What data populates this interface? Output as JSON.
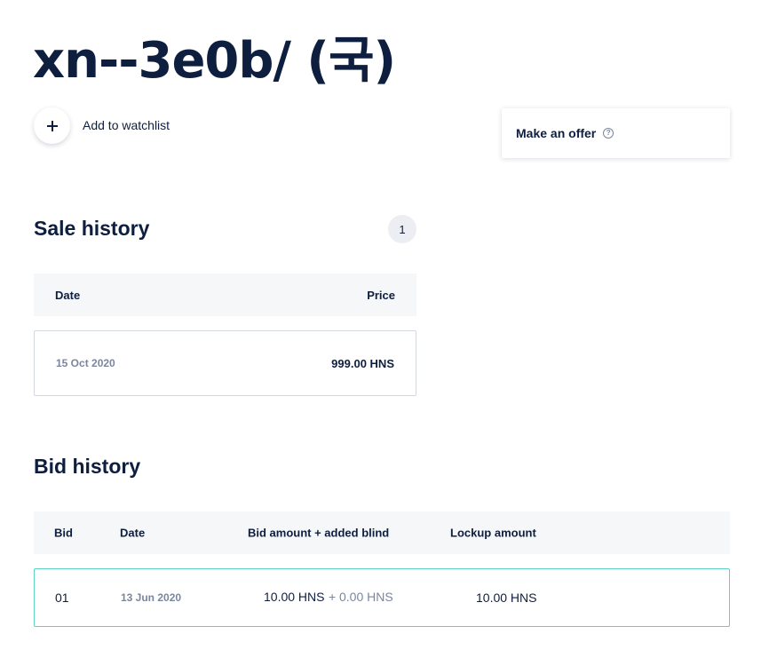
{
  "header": {
    "title": "xn--3e0b/ (국)",
    "watchlist_label": "Add to watchlist",
    "watchlist_icon": "plus-icon"
  },
  "offer": {
    "label": "Make an offer",
    "help_icon": "question-circle-icon",
    "help_glyph": "?"
  },
  "sale_history": {
    "title": "Sale history",
    "count": "1",
    "columns": {
      "date": "Date",
      "price": "Price"
    },
    "rows": [
      {
        "date": "15 Oct 2020",
        "price": "999.00 HNS"
      }
    ]
  },
  "bid_history": {
    "title": "Bid history",
    "columns": {
      "bid": "Bid",
      "date": "Date",
      "amount": "Bid amount + added blind",
      "lockup": "Lockup amount"
    },
    "rows": [
      {
        "bid": "01",
        "date": "13 Jun 2020",
        "bid_amount": "10.00 HNS",
        "blind": "+ 0.00 HNS",
        "lockup": "10.00 HNS"
      }
    ]
  },
  "colors": {
    "text": "#0e1e3f",
    "muted": "#7a869e",
    "header_bg": "#f5f7f9",
    "badge_bg": "#eceef3",
    "highlight_border": "#5fd3c3",
    "row_border": "#d3d7de"
  }
}
